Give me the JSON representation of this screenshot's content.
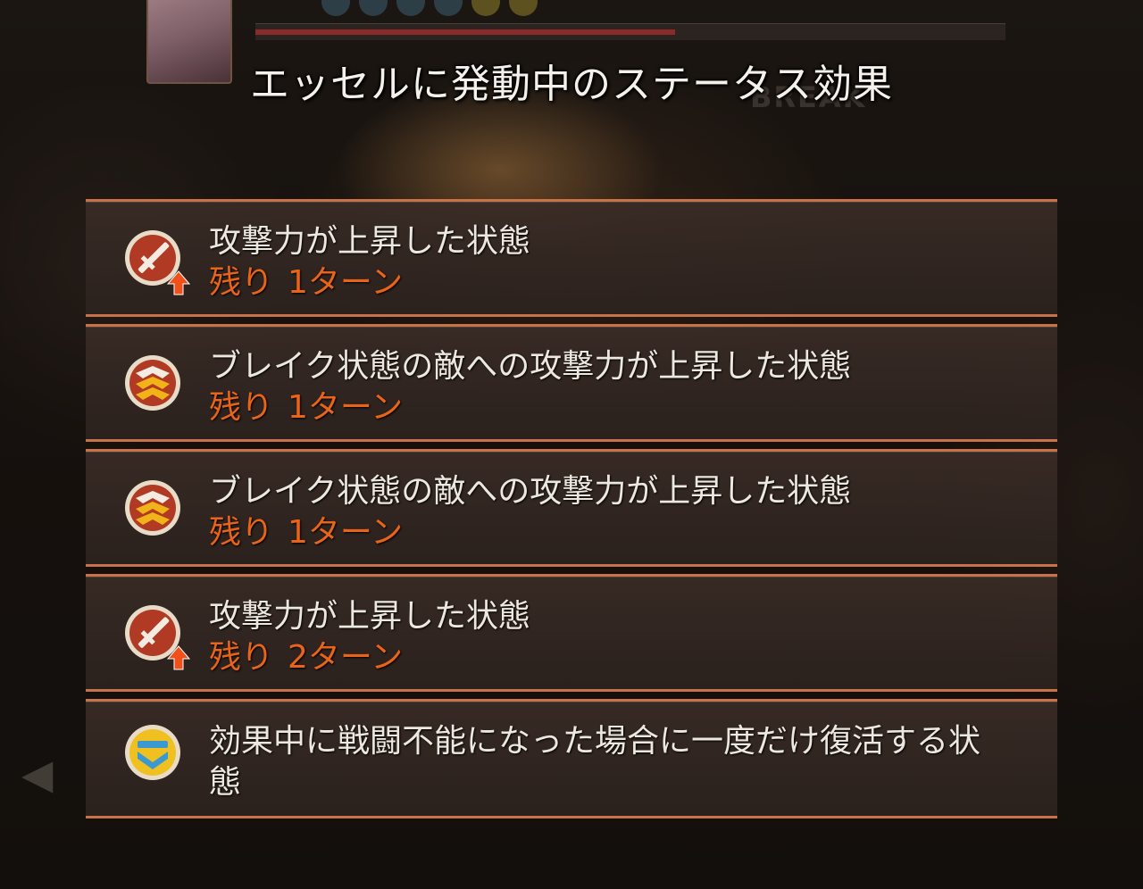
{
  "window": {
    "title": "エッセルに発動中のステータス効果"
  },
  "hp_bar": {
    "fill_fraction": 0.56
  },
  "effects": [
    {
      "name": "攻撃力が上昇した状態",
      "remaining_label": "残り",
      "turns": "1ターン",
      "icon": "attack-up-icon"
    },
    {
      "name": "ブレイク状態の敵への攻撃力が上昇した状態",
      "remaining_label": "残り",
      "turns": "1ターン",
      "icon": "break-attack-up-icon"
    },
    {
      "name": "ブレイク状態の敵への攻撃力が上昇した状態",
      "remaining_label": "残り",
      "turns": "1ターン",
      "icon": "break-attack-up-icon"
    },
    {
      "name": "攻撃力が上昇した状態",
      "remaining_label": "残り",
      "turns": "2ターン",
      "icon": "attack-up-icon"
    },
    {
      "name": "効果中に戦闘不能になった場合に一度だけ復活する状態",
      "icon": "revive-icon"
    }
  ],
  "colors": {
    "row_border": "#c8724a",
    "turns_text": "#e8641a",
    "name_text": "#ece7df"
  }
}
